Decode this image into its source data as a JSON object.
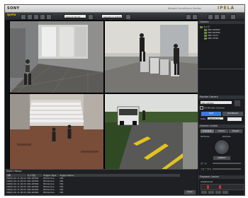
{
  "header": {
    "brand": "SONY",
    "title_note": "Network Surveillance Monitor",
    "product_logo": "IPELA"
  },
  "toolbar": {
    "logo": "ipela",
    "layout_field": "Layout list 04",
    "sequence_field": "Sequence Admin"
  },
  "right_panel": {
    "camera_list_header": "Camera",
    "tree_items": [
      "カメラ",
      "SNC-RZ50N",
      "SNC-RZ30N",
      "SNC-CS11",
      "SNC-DF40"
    ],
    "monitor_section": "Monitor Camera",
    "selected_camera": "SNC-RZ50N",
    "all_monitor_label": "All Monitor Camera",
    "live_button": "LIVE",
    "playback_button": "PLAYBACK",
    "date_label": "Date",
    "date_value": "2008/01/16",
    "camera_control_section": "Camera Control",
    "control_tabs": [
      "Camera",
      "Home",
      "Preset"
    ],
    "optical_label": "OPTICAL",
    "digital_label": "DIGITAL",
    "direct_label": "DIRECT",
    "zoom_label": "ズーム",
    "focus_label": "フォーカス",
    "playback_section": "Playback Control",
    "timeline_date": "2008/01/16"
  },
  "alarm": {
    "header": "Alarm History",
    "columns": [
      "日時",
      "カメラ名",
      "Trigger Type",
      "Trigger Name"
    ],
    "rows": [
      [
        "2008/1/16 11:00:00",
        "SNC-RZ50N",
        "MDCamera",
        "CB1"
      ],
      [
        "2008/1/16 11:00:00",
        "SNC-RZ50N",
        "MDCamera",
        "CB1"
      ],
      [
        "2008/1/16 11:00:00",
        "SNC-RZ50N",
        "MDCamera",
        "CB1"
      ],
      [
        "2008/1/16 11:00:00",
        "SNC-RZ50N",
        "MDCamera",
        "CB1"
      ],
      [
        "2008/1/16 11:00:00",
        "SNC-RZ50N",
        "MDCamera",
        "CB1"
      ],
      [
        "2008/1/16 11:00:00",
        "SNC-RZ50N",
        "MDCamera",
        "CB1"
      ]
    ],
    "clear_button": "Clear"
  },
  "colors": {
    "accent_live": "#3c7be0",
    "tree_icon": "#6d8a3c",
    "timeline_red": "#d03030"
  }
}
